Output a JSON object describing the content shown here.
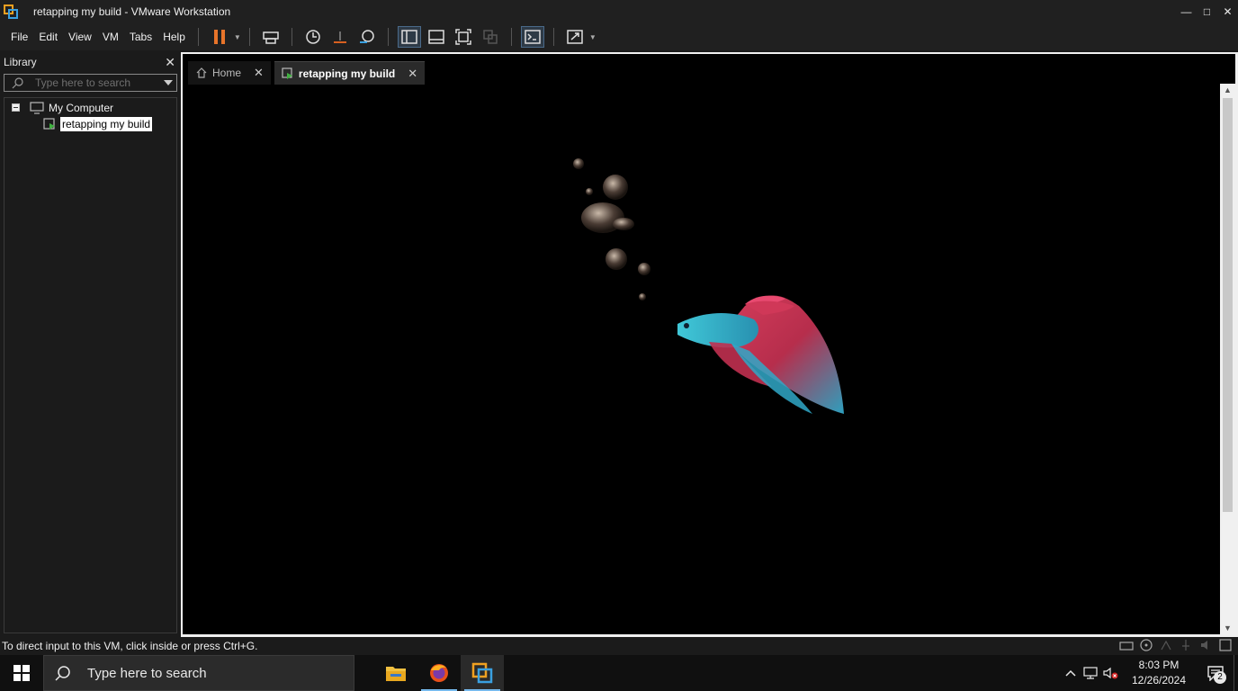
{
  "window": {
    "title": "retapping my build - VMware Workstation",
    "controls": {
      "minimize": "—",
      "maximize": "□",
      "close": "✕"
    }
  },
  "menu": {
    "items": [
      "File",
      "Edit",
      "View",
      "VM",
      "Tabs",
      "Help"
    ]
  },
  "library": {
    "title": "Library",
    "close": "✕",
    "search_placeholder": "Type here to search",
    "tree": {
      "root": "My Computer",
      "vm": "retapping my build"
    }
  },
  "tabs": [
    {
      "label": "Home",
      "close": "✕"
    },
    {
      "label": "retapping my build",
      "close": "✕"
    }
  ],
  "status": {
    "text": "To direct input to this VM, click inside or press Ctrl+G."
  },
  "taskbar": {
    "search_placeholder": "Type here to search",
    "time": "8:03 PM",
    "date": "12/26/2024",
    "notifications": "2"
  },
  "colors": {
    "accent": "#f0a020",
    "vmware_blue": "#3aa0e0",
    "pause": "#e8742a"
  }
}
